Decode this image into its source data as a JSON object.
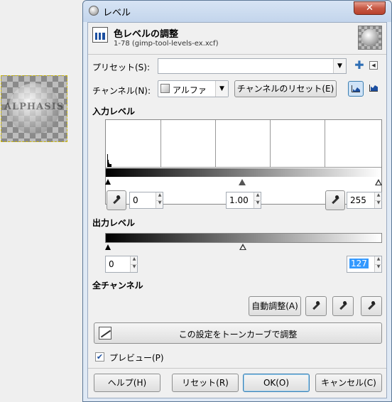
{
  "window": {
    "title": "レベル",
    "close_label": "✕"
  },
  "header": {
    "title": "色レベルの調整",
    "subtitle": "1-78 (gimp-tool-levels-ex.xcf)"
  },
  "preset": {
    "label": "プリセット(S):",
    "value": ""
  },
  "channel": {
    "label": "チャンネル(N):",
    "value": "アルファ",
    "reset_label": "チャンネルのリセット(E)"
  },
  "input_levels": {
    "title": "入力レベル",
    "low": "0",
    "gamma": "1.00",
    "high": "255"
  },
  "output_levels": {
    "title": "出力レベル",
    "low": "0",
    "high": "127"
  },
  "all_channels": {
    "title": "全チャンネル",
    "auto_label": "自動調整(A)"
  },
  "curves_button": {
    "label": "この設定をトーンカーブで調整"
  },
  "preview": {
    "label": "プレビュー(P)",
    "checked": true
  },
  "buttons": {
    "help": "ヘルプ(H)",
    "reset": "リセット(R)",
    "ok": "OK(O)",
    "cancel": "キャンセル(C)"
  },
  "canvas": {
    "logo_text": "ALPHASIS"
  },
  "colors": {
    "selection": "#3399ff",
    "titlebar": "#c3d5ec"
  }
}
